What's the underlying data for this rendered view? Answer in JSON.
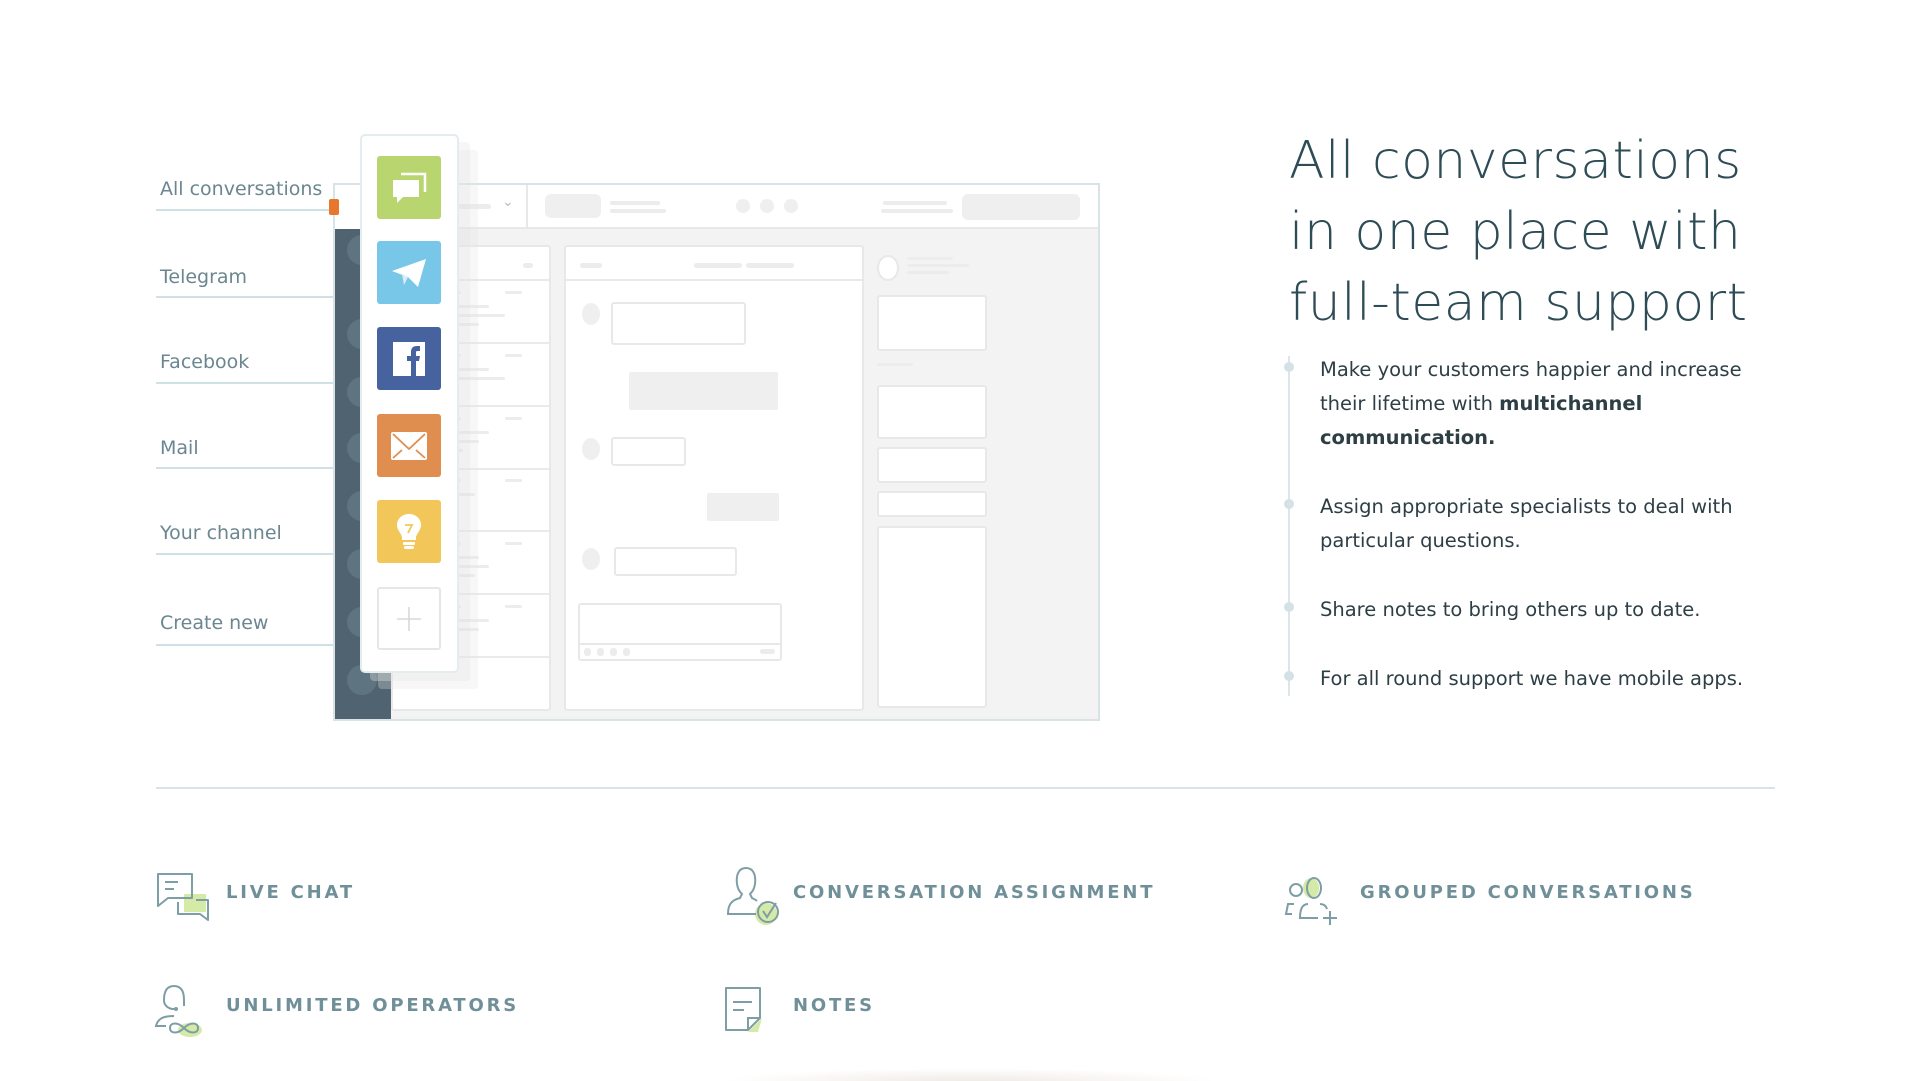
{
  "channels": {
    "items": [
      {
        "label": "All conversations",
        "icon": "chat-bubbles-icon",
        "color": "#b8d56f"
      },
      {
        "label": "Telegram",
        "icon": "telegram-icon",
        "color": "#79c7e8"
      },
      {
        "label": "Facebook",
        "icon": "facebook-icon",
        "color": "#46629f"
      },
      {
        "label": "Mail",
        "icon": "mail-icon",
        "color": "#e08e4f"
      },
      {
        "label": "Your channel",
        "icon": "lightbulb-icon",
        "color": "#f2c659"
      },
      {
        "label": "Create new",
        "icon": "plus-icon",
        "color": "#ffffff"
      }
    ]
  },
  "hero": {
    "title_lines": [
      "All conversations",
      "in one place with",
      "full-team support"
    ],
    "bullets": [
      {
        "text": "Make your customers happier and increase their lifetime with ",
        "bold": "multichannel communication."
      },
      {
        "text": "Assign appropriate specialists to deal with particular questions.",
        "bold": ""
      },
      {
        "text": "Share notes to bring others up to date.",
        "bold": ""
      },
      {
        "text": "For all round support we have mobile apps.",
        "bold": ""
      }
    ]
  },
  "features": [
    {
      "label": "LIVE CHAT",
      "icon": "live-chat-icon"
    },
    {
      "label": "CONVERSATION ASSIGNMENT",
      "icon": "conversation-assignment-icon"
    },
    {
      "label": "GROUPED CONVERSATIONS",
      "icon": "grouped-conversations-icon"
    },
    {
      "label": "UNLIMITED OPERATORS",
      "icon": "unlimited-operators-icon"
    },
    {
      "label": "NOTES",
      "icon": "notes-icon"
    }
  ],
  "colors": {
    "heading": "#2e4c55",
    "feature_label": "#6f8f99",
    "accent_green": "#d5eaa6",
    "sidebar_dark": "#4f6470",
    "active_orange": "#e8772e"
  }
}
